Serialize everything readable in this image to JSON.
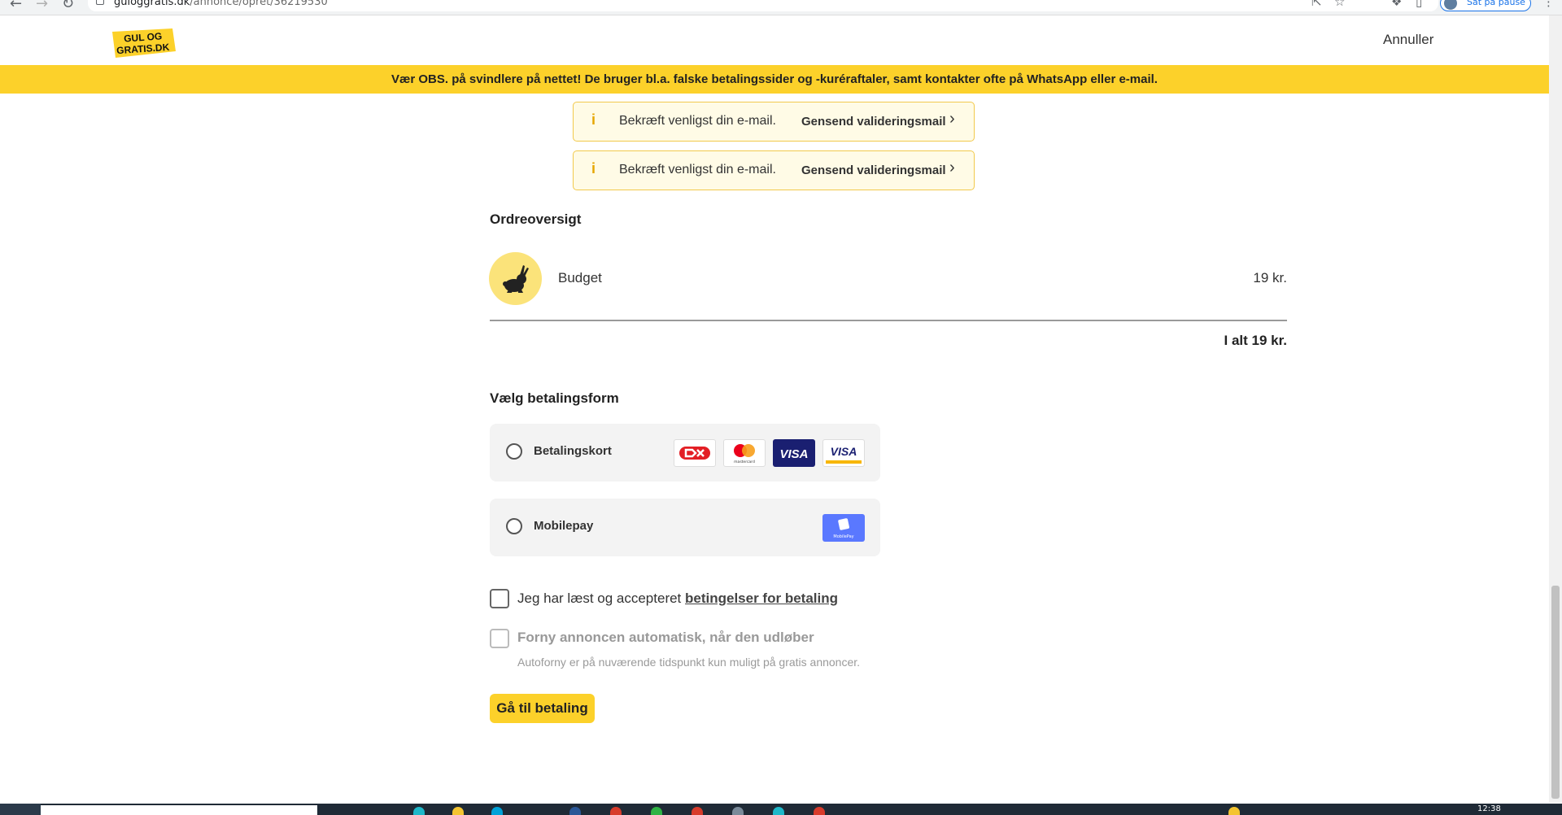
{
  "browser": {
    "url_domain": "guloggratis.dk",
    "url_path": "/annonce/opret/36219530",
    "profile_label": "Sat på pause"
  },
  "header": {
    "logo_line1": "GUL OG",
    "logo_line2": "GRATIS.DK",
    "cancel_label": "Annuller"
  },
  "warning_banner": "Vær OBS. på svindlere på nettet! De bruger bl.a. falske betalingssider og -kuréraftaler, samt kontakter ofte på WhatsApp eller e-mail.",
  "notices": [
    {
      "message": "Bekræft venligst din e-mail.",
      "link": "Gensend valideringsmail"
    },
    {
      "message": "Bekræft venligst din e-mail.",
      "link": "Gensend valideringsmail"
    }
  ],
  "order": {
    "heading": "Ordreoversigt",
    "item_name": "Budget",
    "item_price": "19 kr.",
    "total": "I alt 19 kr."
  },
  "payment": {
    "heading": "Vælg betalingsform",
    "options": [
      {
        "label": "Betalingskort",
        "cards": [
          "dankort",
          "mastercard",
          "visa",
          "visa-electron"
        ]
      },
      {
        "label": "Mobilepay",
        "cards": [
          "mobilepay"
        ]
      }
    ],
    "card_texts": {
      "visa": "VISA",
      "visa_electron": "VISA",
      "mastercard_caption": "mastercard",
      "mobilepay_caption": "MobilePay"
    }
  },
  "terms": {
    "prefix": "Jeg har læst og accepteret ",
    "link": "betingelser for betaling"
  },
  "autorenew": {
    "label": "Forny annoncen automatisk, når den udløber",
    "hint": "Autoforny er på nuværende tidspunkt kun muligt på gratis annoncer."
  },
  "submit_label": "Gå til betaling",
  "taskbar": {
    "clock": "12:38"
  },
  "colors": {
    "brand_yellow": "#fcd12a",
    "notice_bg": "#fffbe6",
    "notice_border": "#f2c94c",
    "mobilepay_blue": "#5a78ff",
    "visa_navy": "#1a1f71"
  }
}
